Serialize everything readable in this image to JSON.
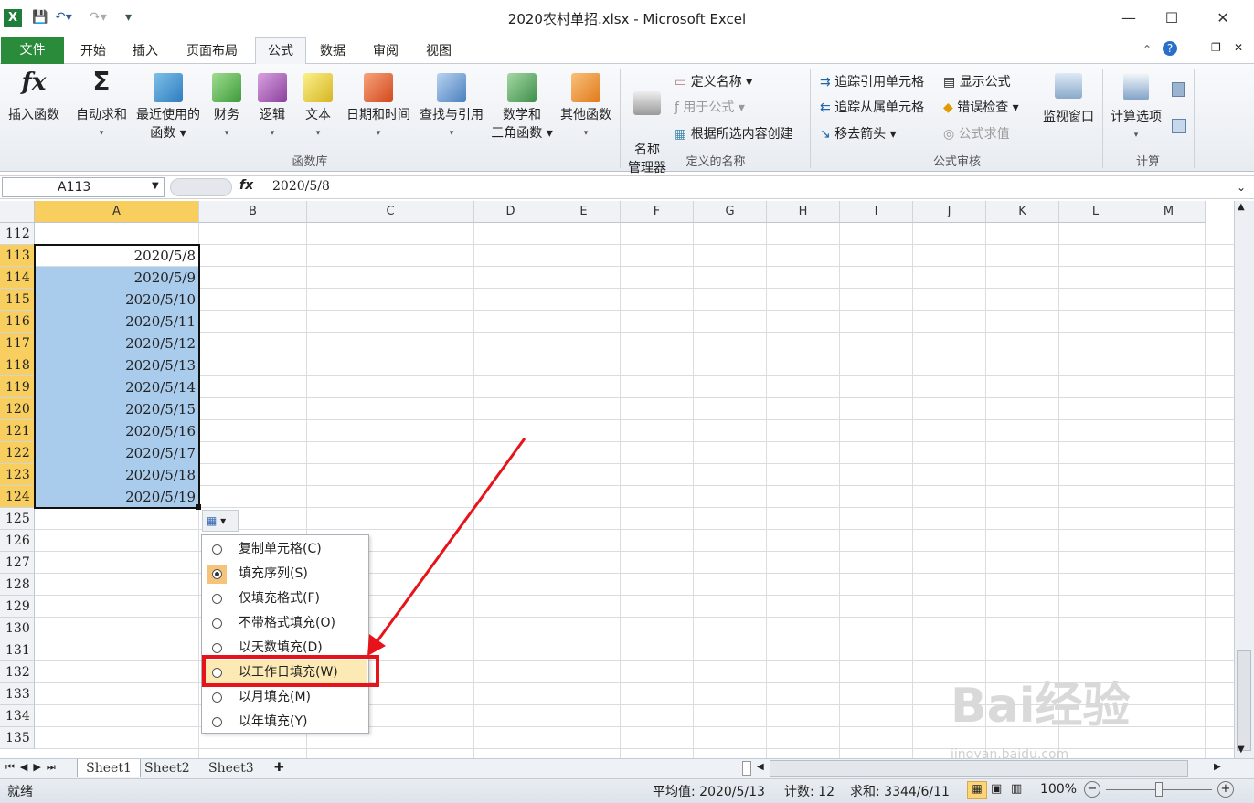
{
  "window": {
    "title": "2020农村单招.xlsx - Microsoft Excel",
    "minimize": "—",
    "maximize": "☐",
    "close": "✕"
  },
  "tabs": [
    "开始",
    "插入",
    "页面布局",
    "公式",
    "数据",
    "审阅",
    "视图"
  ],
  "file_tab": "文件",
  "ribbon": {
    "groups": {
      "library": "函数库",
      "names": "定义的名称",
      "audit": "公式审核",
      "calc": "计算"
    },
    "library": [
      {
        "label": "插入函数",
        "sub": "",
        "icon": "function-icon"
      },
      {
        "label": "自动求和",
        "sub": "▾",
        "icon": "sigma-icon"
      },
      {
        "label": "最近使用的",
        "sub": "函数 ▾",
        "icon": "star-book-icon"
      },
      {
        "label": "财务",
        "sub": "▾",
        "icon": "finance-book-icon"
      },
      {
        "label": "逻辑",
        "sub": "▾",
        "icon": "logic-book-icon"
      },
      {
        "label": "文本",
        "sub": "▾",
        "icon": "text-book-icon"
      },
      {
        "label": "日期和时间",
        "sub": "▾",
        "icon": "clock-book-icon"
      },
      {
        "label": "查找与引用",
        "sub": "▾",
        "icon": "lookup-book-icon"
      },
      {
        "label": "数学和",
        "sub": "三角函数 ▾",
        "icon": "math-book-icon"
      },
      {
        "label": "其他函数",
        "sub": "▾",
        "icon": "other-books-icon"
      }
    ],
    "name_manager": "名称\n管理器",
    "define_name": "定义名称 ▾",
    "use_in_formula": "用于公式 ▾",
    "create_from_sel": "根据所选内容创建",
    "trace_precedents": "追踪引用单元格",
    "trace_dependents": "追踪从属单元格",
    "remove_arrows": "移去箭头 ▾",
    "show_formulas": "显示公式",
    "error_check": "错误检查 ▾",
    "evaluate": "公式求值",
    "watch": "监视窗口",
    "calc_options": "计算选项"
  },
  "formula_bar": {
    "name_box": "A113",
    "fx": "fx",
    "value": "2020/5/8"
  },
  "columns": [
    "A",
    "B",
    "C",
    "D",
    "E",
    "F",
    "G",
    "H",
    "I",
    "J",
    "K",
    "L",
    "M"
  ],
  "rows": [
    "112",
    "113",
    "114",
    "115",
    "116",
    "117",
    "118",
    "119",
    "120",
    "121",
    "122",
    "123",
    "124",
    "125",
    "126",
    "127",
    "128",
    "129",
    "130",
    "131",
    "132",
    "133",
    "134",
    "135"
  ],
  "cells": [
    "2020/5/8",
    "2020/5/9",
    "2020/5/10",
    "2020/5/11",
    "2020/5/12",
    "2020/5/13",
    "2020/5/14",
    "2020/5/15",
    "2020/5/16",
    "2020/5/17",
    "2020/5/18",
    "2020/5/19"
  ],
  "autofill_menu": [
    "复制单元格(C)",
    "填充序列(S)",
    "仅填充格式(F)",
    "不带格式填充(O)",
    "以天数填充(D)",
    "以工作日填充(W)",
    "以月填充(M)",
    "以年填充(Y)"
  ],
  "sheets": [
    "Sheet1",
    "Sheet2",
    "Sheet3"
  ],
  "status": {
    "ready": "就绪",
    "average": "平均值: 2020/5/13",
    "count": "计数: 12",
    "sum": "求和: 3344/6/11",
    "zoom": "100%"
  },
  "watermark": {
    "main": "Bai经验",
    "sub": "jingyan.baidu.com"
  }
}
